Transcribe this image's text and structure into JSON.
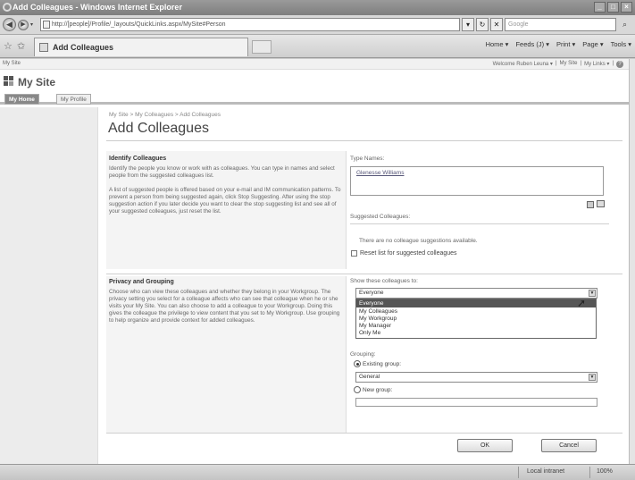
{
  "window": {
    "title": "Add Colleagues - Windows Internet Explorer",
    "controls": [
      "_",
      "□",
      "×"
    ]
  },
  "addressbar": {
    "url": "http://[people]/Profile/_layouts/QuickLinks.aspx/MySite#Person",
    "search_placeholder": "Google"
  },
  "tabbar": {
    "tab_label": "Add Colleagues",
    "commands": [
      "Home ▾",
      "Feeds (J) ▾",
      "Print ▾",
      "Page ▾",
      "Tools ▾"
    ]
  },
  "sp": {
    "top_left": "My Site",
    "top_right": [
      "Welcome Ruben Leuna ▾",
      "My Site",
      "My Links ▾"
    ],
    "site_title": "My Site",
    "tabs": [
      "My Home",
      "My Profile"
    ],
    "breadcrumb": "My Site > My Colleagues > Add Colleagues",
    "page_title": "Add Colleagues"
  },
  "identify": {
    "heading": "Identify Colleagues",
    "para1": "Identify the people you know or work with as colleagues. You can type in names and select people from the suggested colleagues list.",
    "para2": "A list of suggested people is offered based on your e-mail and IM communication patterns. To prevent a person from being suggested again, click Stop Suggesting. After using the stop suggestion action if you later decide you want to clear the stop suggesting list and see all of your suggested colleagues, just reset the list.",
    "type_names_label": "Type Names:",
    "type_names_value": "Glenesse Williams",
    "suggested_label": "Suggested Colleagues:",
    "no_suggestions": "There are no colleague suggestions available.",
    "reset_label": "Reset list for suggested colleagues"
  },
  "privacy": {
    "heading": "Privacy and Grouping",
    "para": "Choose who can view these colleagues and whether they belong in your Workgroup. The privacy setting you select for a colleague affects who can see that colleague when he or she visits your My Site. You can also choose to add a colleague to your Workgroup. Doing this gives the colleague the privilege to view content that you set to My Workgroup. Use grouping to help organize and provide context for added colleagues.",
    "show_label": "Show these colleagues to:",
    "show_selected": "Everyone",
    "options": [
      "Everyone",
      "My Colleagues",
      "My Workgroup",
      "My Manager",
      "Only Me"
    ],
    "grouping_label": "Grouping:",
    "existing_group_label": "Existing group:",
    "existing_group_value": "General",
    "new_group_label": "New group:"
  },
  "buttons": {
    "ok": "OK",
    "cancel": "Cancel"
  },
  "statusbar": {
    "zone": "Local intranet",
    "zoom": "100%"
  }
}
